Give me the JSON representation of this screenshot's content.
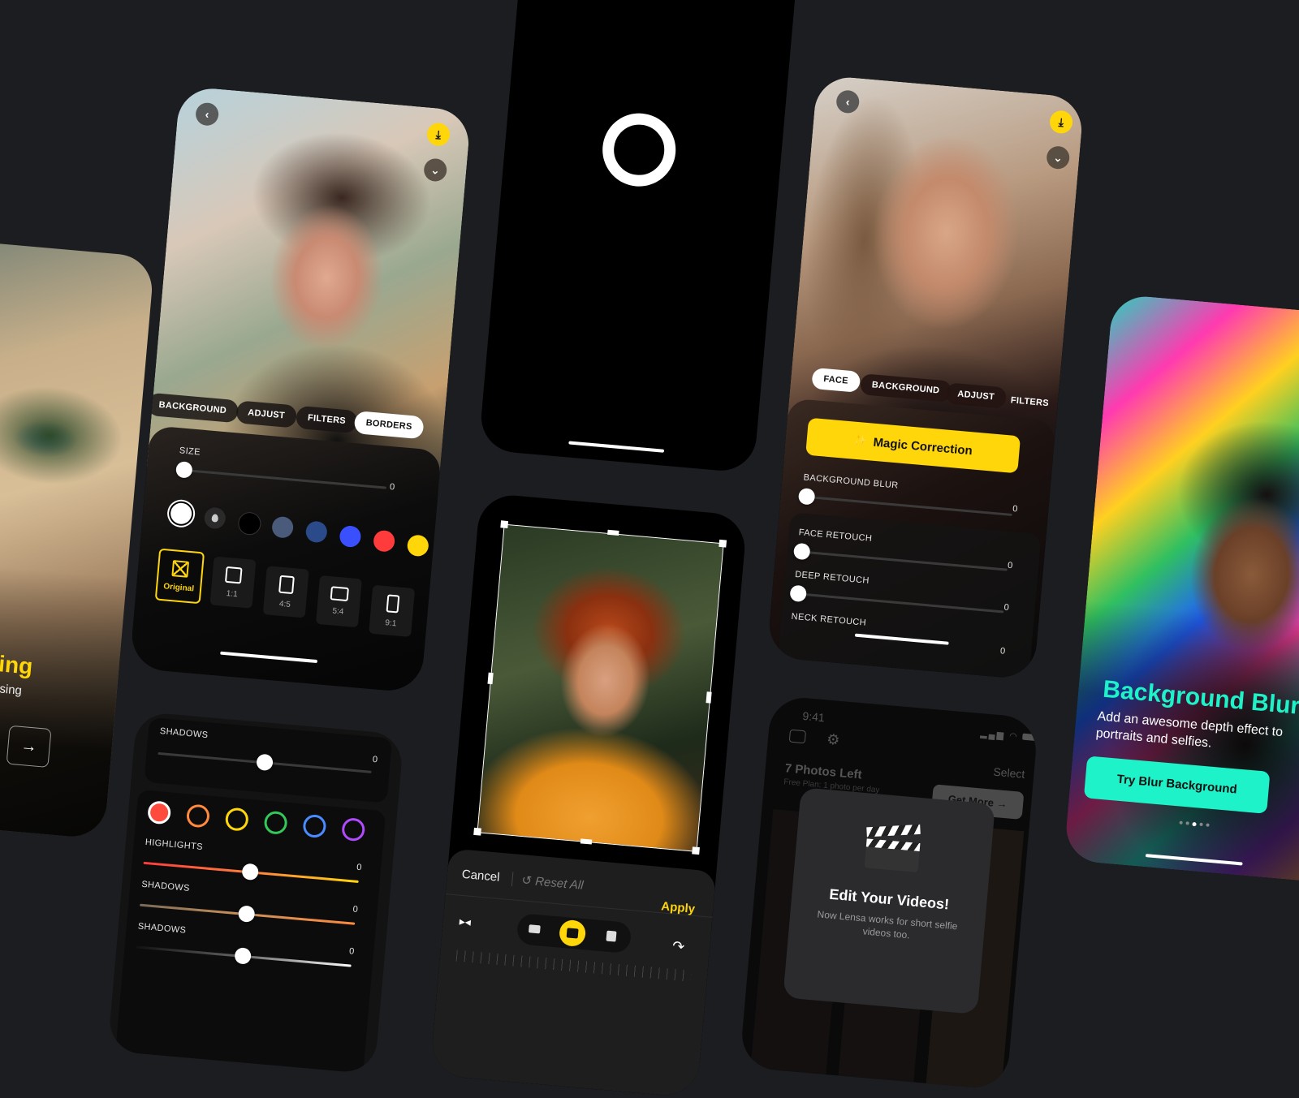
{
  "background_color": "#1c1d21",
  "accent_yellow": "#ffd60a",
  "accent_teal": "#1ef2c9",
  "screens": {
    "onboarding_left": {
      "title_fragment": "iting",
      "subtitle_fragment": "o using",
      "next_icon": "arrow-right-icon",
      "next_glyph": "→"
    },
    "borders_editor": {
      "back_glyph": "‹",
      "download_glyph": "⤓",
      "collapse_glyph": "⌄",
      "tabs": [
        {
          "label": "BACKGROUND",
          "active": false
        },
        {
          "label": "ADJUST",
          "active": false
        },
        {
          "label": "FILTERS",
          "active": false
        },
        {
          "label": "BORDERS",
          "active": true
        }
      ],
      "size_label": "SIZE",
      "size_value": "0",
      "size_fraction": 0,
      "colors": [
        "#ffffff",
        "dropper",
        "#000000",
        "#4a5a7a",
        "#2a4a8a",
        "#3a50ff",
        "#ff3b3b",
        "#ffd60a"
      ],
      "selected_color": "#ffffff",
      "ratios": [
        {
          "label": "Original",
          "active": true
        },
        {
          "label": "1:1",
          "active": false
        },
        {
          "label": "4:5",
          "active": false
        },
        {
          "label": "5:4",
          "active": false
        },
        {
          "label": "9:1",
          "active": false
        }
      ]
    },
    "splash": {
      "logo_icon": "ring-logo-icon"
    },
    "crop_editor": {
      "cancel_label": "Cancel",
      "reset_label": "Reset All",
      "reset_glyph": "↺",
      "apply_label": "Apply",
      "mirror_glyph": "▸◂",
      "rotate_glyph": "↷",
      "modes": [
        "horizontal-skew",
        "straighten",
        "vertical-skew"
      ],
      "active_mode": "straighten"
    },
    "hsl_panel": {
      "top_label": "SHADOWS",
      "top_value": "0",
      "top_fraction": 0.5,
      "color_rings": [
        "#ff4b3e",
        "#ff8a3d",
        "#ffd60a",
        "#34c759",
        "#4a8cff",
        "#b04aff"
      ],
      "selected_ring": "#ff4b3e",
      "sliders": [
        {
          "label": "HIGHLIGHTS",
          "value": "0",
          "fraction": 0.5
        },
        {
          "label": "SHADOWS",
          "value": "0",
          "fraction": 0.5
        },
        {
          "label": "SHADOWS",
          "value": "0",
          "fraction": 0.5
        }
      ]
    },
    "face_editor": {
      "back_glyph": "‹",
      "download_glyph": "⤓",
      "collapse_glyph": "⌄",
      "tabs": [
        {
          "label": "FACE",
          "active": true
        },
        {
          "label": "BACKGROUND",
          "active": false
        },
        {
          "label": "ADJUST",
          "active": false
        },
        {
          "label": "FILTERS",
          "active": false
        }
      ],
      "magic_label": "Magic Correction",
      "magic_glyph": "✨",
      "sliders": [
        {
          "label": "BACKGROUND BLUR",
          "value": "0",
          "fraction": 0
        },
        {
          "label": "FACE RETOUCH",
          "value": "0",
          "fraction": 0
        },
        {
          "label": "DEEP RETOUCH",
          "value": "0",
          "fraction": 0
        },
        {
          "label": "NECK RETOUCH",
          "value": "0",
          "fraction": 0
        }
      ]
    },
    "library": {
      "time": "9:41",
      "select_label": "Select",
      "photos_left": "7 Photos Left",
      "plan_text": "Free Plan: 1 photo per day",
      "get_more_label": "Get More →",
      "modal_title": "Edit Your Videos!",
      "modal_body": "Now Lensa works for short selfie videos too.",
      "modal_icon": "clapperboard-icon"
    },
    "blur_promo": {
      "title": "Background Blur",
      "body": "Add an awesome depth effect to portraits and selfies.",
      "cta_label": "Try Blur Background",
      "page_count": 5,
      "current_page": 3
    }
  }
}
